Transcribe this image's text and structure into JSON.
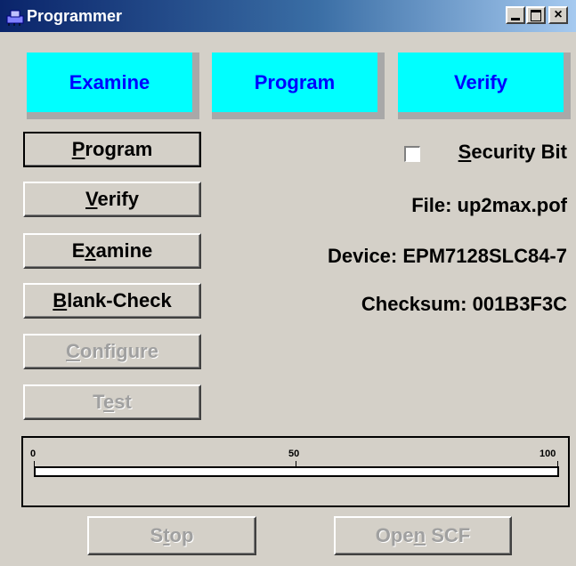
{
  "window": {
    "title": "Programmer"
  },
  "titlebar": {
    "minimize_label": "_",
    "maximize_label": "□",
    "close_label": "×"
  },
  "mode_tiles": [
    "Examine",
    "Program",
    "Verify"
  ],
  "buttons": [
    {
      "label": "Program",
      "mnemonic_index": 0,
      "enabled": true,
      "default": true
    },
    {
      "label": "Verify",
      "mnemonic_index": 0,
      "enabled": true,
      "default": false
    },
    {
      "label": "Examine",
      "mnemonic_index": 1,
      "enabled": true,
      "default": false
    },
    {
      "label": "Blank-Check",
      "mnemonic_index": 0,
      "enabled": true,
      "default": false
    },
    {
      "label": "Configure",
      "mnemonic_index": 0,
      "enabled": false,
      "default": false
    },
    {
      "label": "Test",
      "mnemonic_index": 1,
      "enabled": false,
      "default": false
    }
  ],
  "security_bit": {
    "label": "Security Bit",
    "checked": false
  },
  "info": {
    "file": "File: up2max.pof",
    "device": "Device: EPM7128SLC84-7",
    "checksum": "Checksum: 001B3F3C"
  },
  "progress": {
    "value": 0,
    "tick_labels": [
      "0",
      "50",
      "100"
    ]
  },
  "bottom_buttons": [
    {
      "label": "Stop",
      "mnemonic_index": 1,
      "enabled": false
    },
    {
      "label": "Open SCF",
      "mnemonic_index": 3,
      "enabled": false
    }
  ],
  "colors": {
    "tile_bg": "#00ffff",
    "tile_text": "#0000ff",
    "progress_fill": "#000080"
  }
}
